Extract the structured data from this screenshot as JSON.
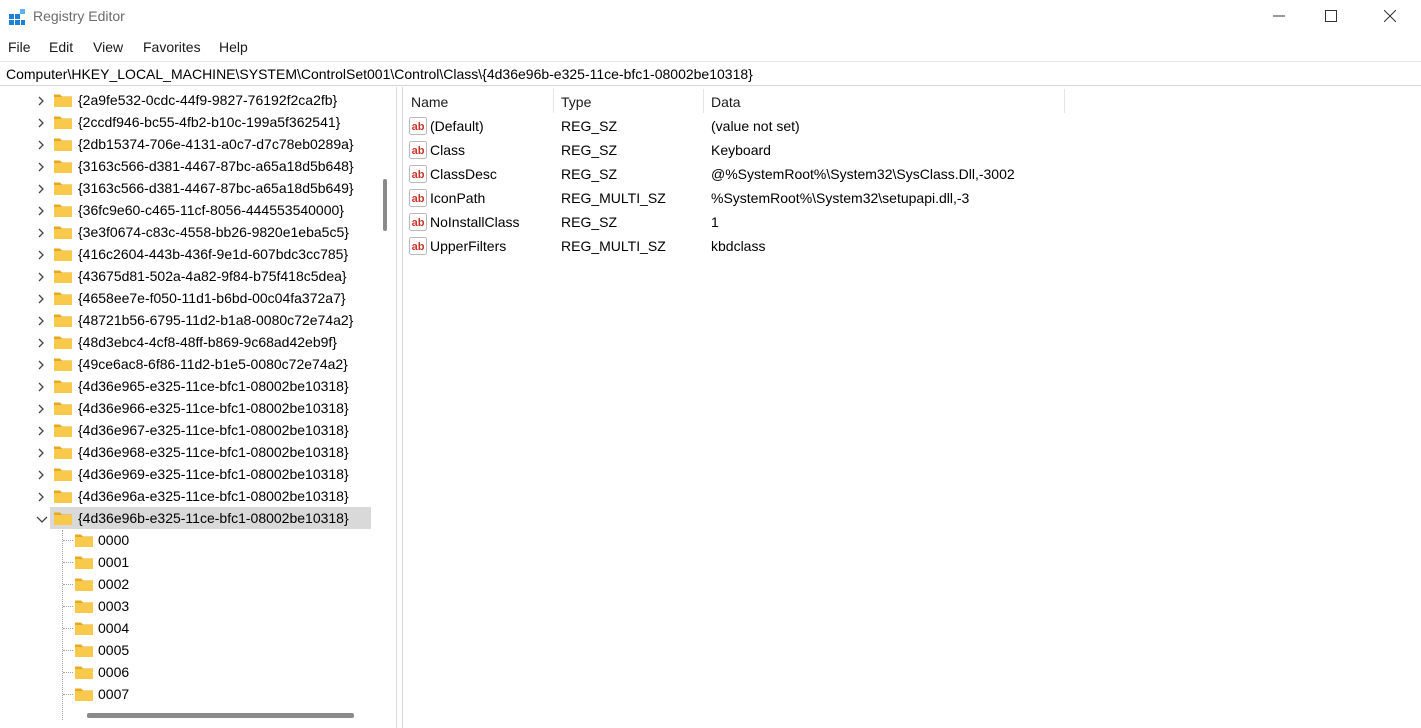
{
  "window": {
    "title": "Registry Editor"
  },
  "menu": [
    "File",
    "Edit",
    "View",
    "Favorites",
    "Help"
  ],
  "address": "Computer\\HKEY_LOCAL_MACHINE\\SYSTEM\\ControlSet001\\Control\\Class\\{4d36e96b-e325-11ce-bfc1-08002be10318}",
  "tree": {
    "keys": [
      "{2a9fe532-0cdc-44f9-9827-76192f2ca2fb}",
      "{2ccdf946-bc55-4fb2-b10c-199a5f362541}",
      "{2db15374-706e-4131-a0c7-d7c78eb0289a}",
      "{3163c566-d381-4467-87bc-a65a18d5b648}",
      "{3163c566-d381-4467-87bc-a65a18d5b649}",
      "{36fc9e60-c465-11cf-8056-444553540000}",
      "{3e3f0674-c83c-4558-bb26-9820e1eba5c5}",
      "{416c2604-443b-436f-9e1d-607bdc3cc785}",
      "{43675d81-502a-4a82-9f84-b75f418c5dea}",
      "{4658ee7e-f050-11d1-b6bd-00c04fa372a7}",
      "{48721b56-6795-11d2-b1a8-0080c72e74a2}",
      "{48d3ebc4-4cf8-48ff-b869-9c68ad42eb9f}",
      "{49ce6ac8-6f86-11d2-b1e5-0080c72e74a2}",
      "{4d36e965-e325-11ce-bfc1-08002be10318}",
      "{4d36e966-e325-11ce-bfc1-08002be10318}",
      "{4d36e967-e325-11ce-bfc1-08002be10318}",
      "{4d36e968-e325-11ce-bfc1-08002be10318}",
      "{4d36e969-e325-11ce-bfc1-08002be10318}",
      "{4d36e96a-e325-11ce-bfc1-08002be10318}",
      "{4d36e96b-e325-11ce-bfc1-08002be10318}"
    ],
    "selected": "{4d36e96b-e325-11ce-bfc1-08002be10318}",
    "children": [
      "0000",
      "0001",
      "0002",
      "0003",
      "0004",
      "0005",
      "0006",
      "0007"
    ]
  },
  "values": {
    "columns": {
      "name": "Name",
      "type": "Type",
      "data": "Data"
    },
    "rows": [
      {
        "name": "(Default)",
        "type": "REG_SZ",
        "data": "(value not set)"
      },
      {
        "name": "Class",
        "type": "REG_SZ",
        "data": "Keyboard"
      },
      {
        "name": "ClassDesc",
        "type": "REG_SZ",
        "data": "@%SystemRoot%\\System32\\SysClass.Dll,-3002"
      },
      {
        "name": "IconPath",
        "type": "REG_MULTI_SZ",
        "data": "%SystemRoot%\\System32\\setupapi.dll,-3"
      },
      {
        "name": "NoInstallClass",
        "type": "REG_SZ",
        "data": "1"
      },
      {
        "name": "UpperFilters",
        "type": "REG_MULTI_SZ",
        "data": "kbdclass"
      }
    ]
  },
  "icons": {
    "app": "registry-cubes-icon",
    "folder": "folder-icon",
    "value": "string-value-ab-icon",
    "expand": "chevron-right-icon",
    "collapse": "chevron-down-icon"
  },
  "colors": {
    "folder": "#f8c94a",
    "folder_dark": "#e4a91f",
    "ab_red": "#c8352a",
    "selection": "#d9d9d9"
  }
}
